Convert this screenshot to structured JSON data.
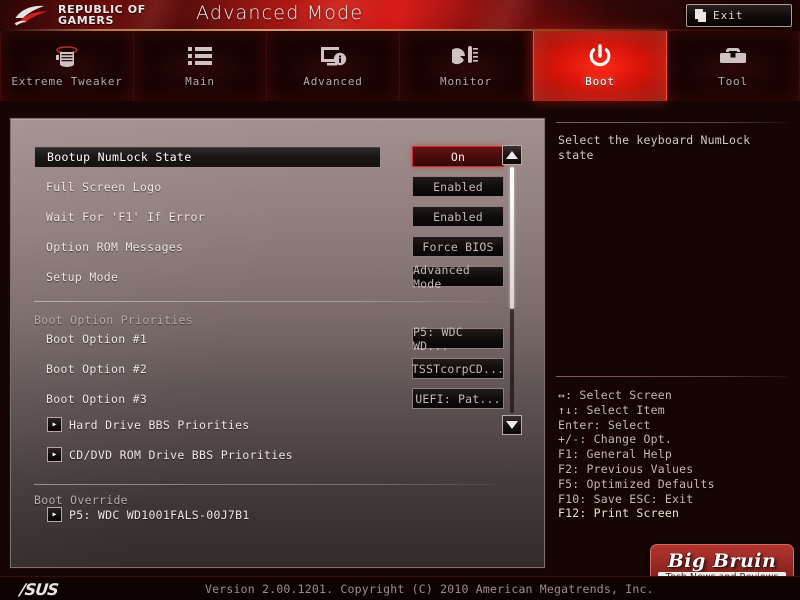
{
  "header": {
    "brand_line1": "REPUBLIC OF",
    "brand_line2": "GAMERS",
    "title": "Advanced Mode",
    "exit_label": "Exit",
    "exit_icon": "exit-door-icon",
    "rog_icon": "rog-eye-logo-icon"
  },
  "tabs": [
    {
      "label": "Extreme Tweaker",
      "icon": "overclock-cylinder-icon",
      "active": false
    },
    {
      "label": "Main",
      "icon": "list-icon",
      "active": false
    },
    {
      "label": "Advanced",
      "icon": "monitor-info-icon",
      "active": false
    },
    {
      "label": "Monitor",
      "icon": "thermometer-gauge-icon",
      "active": false
    },
    {
      "label": "Boot",
      "icon": "power-icon",
      "active": true
    },
    {
      "label": "Tool",
      "icon": "toolbox-icon",
      "active": false
    }
  ],
  "settings": [
    {
      "label": "Bootup NumLock State",
      "value": "On",
      "selected": true
    },
    {
      "label": "Full Screen Logo",
      "value": "Enabled",
      "selected": false
    },
    {
      "label": "Wait For 'F1' If Error",
      "value": "Enabled",
      "selected": false
    },
    {
      "label": "Option ROM Messages",
      "value": "Force BIOS",
      "selected": false
    },
    {
      "label": "Setup Mode",
      "value": "Advanced Mode",
      "selected": false
    }
  ],
  "boot_priorities": {
    "heading": "Boot Option Priorities",
    "options": [
      {
        "label": "Boot Option #1",
        "value": "P5: WDC WD..."
      },
      {
        "label": "Boot Option #2",
        "value": "TSSTcorpCD..."
      },
      {
        "label": "Boot Option #3",
        "value": "UEFI:  Pat..."
      }
    ]
  },
  "bbs_items": [
    {
      "label": "Hard Drive BBS Priorities",
      "arrow": "chevron-right-icon"
    },
    {
      "label": "CD/DVD ROM Drive BBS Priorities",
      "arrow": "chevron-right-icon"
    }
  ],
  "boot_override": {
    "heading": "Boot Override",
    "items": [
      {
        "label": "P5: WDC WD1001FALS-00J7B1",
        "arrow": "chevron-right-icon"
      }
    ]
  },
  "scrollbar": {
    "up_icon": "triangle-up-icon",
    "down_icon": "triangle-down-icon"
  },
  "help": {
    "text": "Select the keyboard NumLock state"
  },
  "legend": [
    {
      "text": "↔: Select Screen",
      "highlight": false
    },
    {
      "text": "↑↓: Select Item",
      "highlight": false
    },
    {
      "text": "Enter: Select",
      "highlight": false
    },
    {
      "text": "+/-: Change Opt.",
      "highlight": false
    },
    {
      "text": "F1: General Help",
      "highlight": false
    },
    {
      "text": "F2: Previous Values",
      "highlight": false
    },
    {
      "text": "F5: Optimized Defaults",
      "highlight": false
    },
    {
      "text": "F10: Save  ESC: Exit",
      "highlight": false
    },
    {
      "text": "F12: Print Screen",
      "highlight": true
    }
  ],
  "watermark": {
    "title": "Big Bruin",
    "subtitle": "Tech News and Reviews"
  },
  "footer": {
    "logo": "/SUS",
    "version": "Version 2.00.1201. Copyright (C) 2010 American Megatrends, Inc."
  },
  "colors": {
    "accent_red": "#c11515",
    "active_tab": "#ff2a18",
    "panel_light": "#a2908f",
    "selected_value": "#4a0c0c",
    "legend_highlight": "#f3e6c2"
  }
}
